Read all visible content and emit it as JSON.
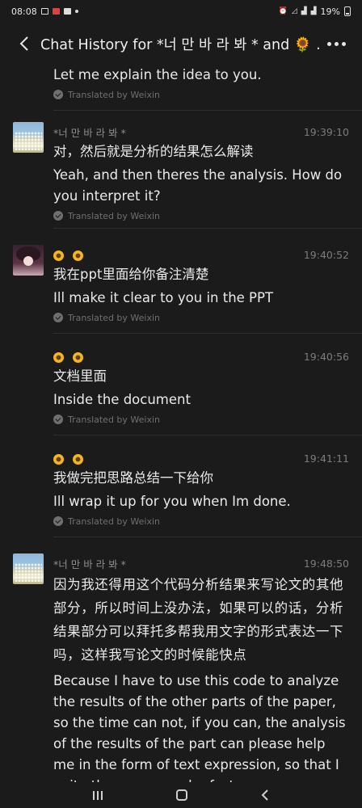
{
  "status_bar": {
    "time": "08:08",
    "battery": "19%"
  },
  "header": {
    "title": "Chat History for *너 만 바 라 봐 * and 🌻  ..."
  },
  "messages": [
    {
      "sender": "",
      "time": "",
      "original": "",
      "translation": "Let me explain the idea to you.",
      "translated_by": "Translated by Weixin"
    },
    {
      "sender": "*너 만 바 라 봐 *",
      "time": "19:39:10",
      "original": "对，然后就是分析的结果怎么解读",
      "translation": "Yeah, and then theres the analysis. How do you interpret it?",
      "translated_by": "Translated by Weixin"
    },
    {
      "sender": "🌻 🌻",
      "time": "19:40:52",
      "original": "我在ppt里面给你备注清楚",
      "translation": "Ill make it clear to you in the PPT",
      "translated_by": "Translated by Weixin"
    },
    {
      "sender": "🌻 🌻",
      "time": "19:40:56",
      "original": "文档里面",
      "translation": "Inside the document",
      "translated_by": "Translated by Weixin"
    },
    {
      "sender": "🌻 🌻",
      "time": "19:41:11",
      "original": "我做完把思路总结一下给你",
      "translation": "Ill wrap it up for you when Im done.",
      "translated_by": "Translated by Weixin"
    },
    {
      "sender": "*너 만 바 라 봐 *",
      "time": "19:48:50",
      "original": "因为我还得用这个代码分析结果来写论文的其他部分，所以时间上没办法，如果可以的话，分析结果部分可以拜托多帮我用文字的形式表达一下吗，这样我写论文的时候能快点",
      "translation": "Because I have to use this code to analyze the results of the other parts of the paper, so the time can not, if you can, the analysis of the results of the part can please help me in the form of text expression, so that I write the paper can be faster",
      "translated_by": ""
    }
  ]
}
